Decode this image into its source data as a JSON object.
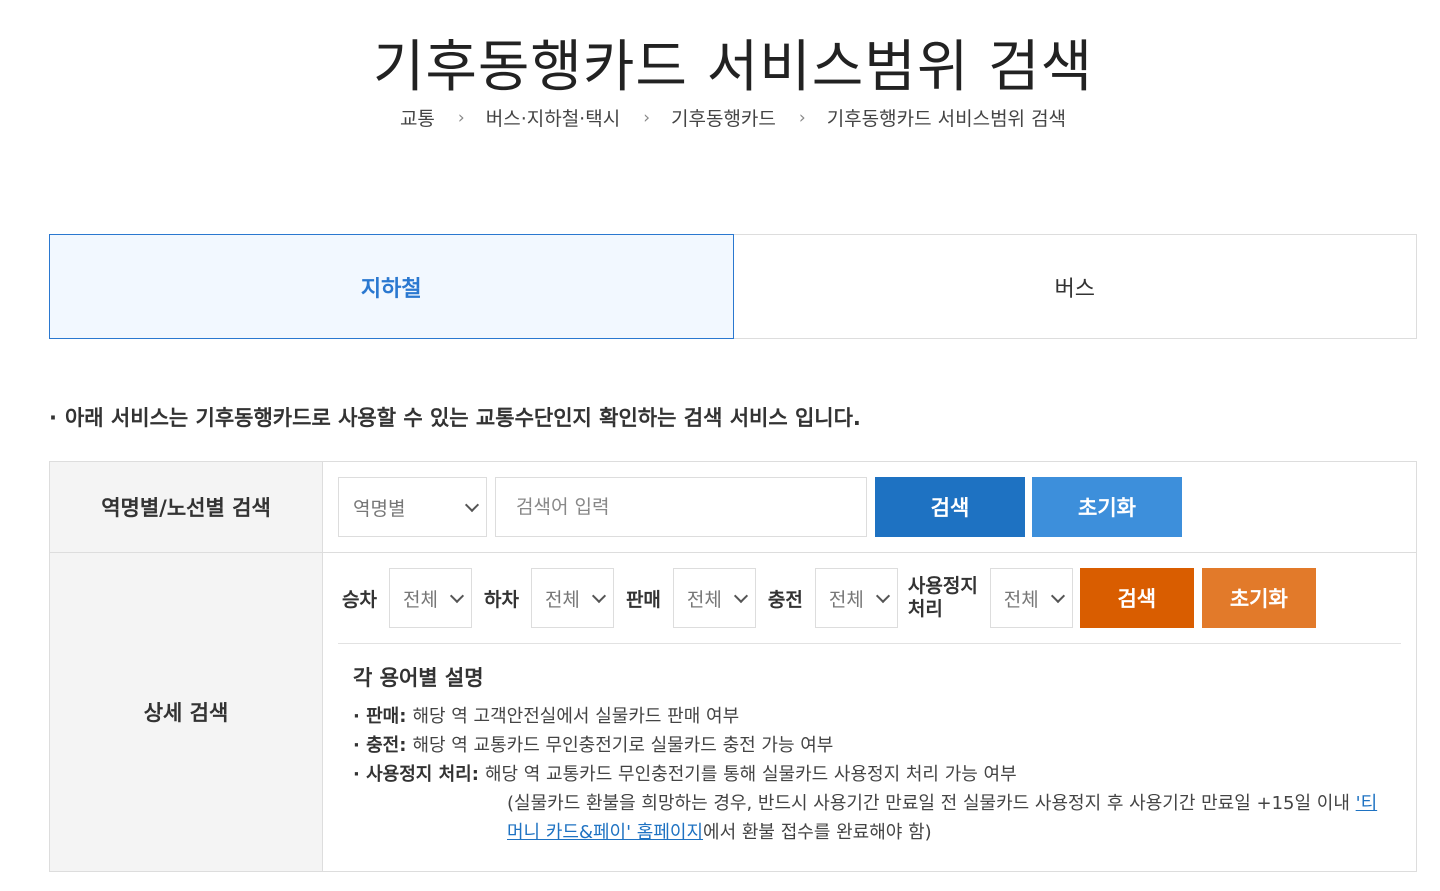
{
  "page": {
    "title": "기후동행카드 서비스범위 검색",
    "breadcrumb": [
      "교통",
      "버스·지하철·택시",
      "기후동행카드",
      "기후동행카드 서비스범위 검색"
    ]
  },
  "tabs": [
    {
      "label": "지하철",
      "active": true
    },
    {
      "label": "버스",
      "active": false
    }
  ],
  "notice": "아래 서비스는 기후동행카드로 사용할 수 있는 교통수단인지 확인하는 검색 서비스 입니다.",
  "station_search": {
    "header": "역명별/노선별 검색",
    "select_value": "역명별",
    "input_placeholder": "검색어 입력",
    "search_label": "검색",
    "reset_label": "초기화"
  },
  "detail_search": {
    "header": "상세 검색",
    "filters": [
      {
        "label": "승차",
        "value": "전체"
      },
      {
        "label": "하차",
        "value": "전체"
      },
      {
        "label": "판매",
        "value": "전체"
      },
      {
        "label": "충전",
        "value": "전체"
      },
      {
        "label_line1": "사용정지",
        "label_line2": "처리",
        "value": "전체"
      }
    ],
    "search_label": "검색",
    "reset_label": "초기화",
    "terms_title": "각 용어별 설명",
    "terms": [
      {
        "label": "판매:",
        "desc": "해당 역 고객안전실에서 실물카드 판매 여부"
      },
      {
        "label": "충전:",
        "desc": "해당 역 교통카드 무인충전기로 실물카드 충전 가능 여부"
      },
      {
        "label": "사용정지 처리:",
        "desc": "해당 역 교통카드 무인충전기를 통해 실물카드 사용정지 처리 가능 여부"
      }
    ],
    "note_before": "(실물카드 환불을 희망하는 경우, 반드시 사용기간 만료일 전 실물카드 사용정지 후 사용기간 만료일 +15일 이내 ",
    "note_link": "'티머니 카드&페이' 홈페이지",
    "note_after": "에서 환불 접수를 완료해야 함)"
  },
  "colors": {
    "accent_blue": "#1e72c2",
    "light_blue": "#3d8fdb",
    "accent_orange": "#d95d00",
    "light_orange": "#e27a2a",
    "active_tab_bg": "#f2f8ff"
  }
}
